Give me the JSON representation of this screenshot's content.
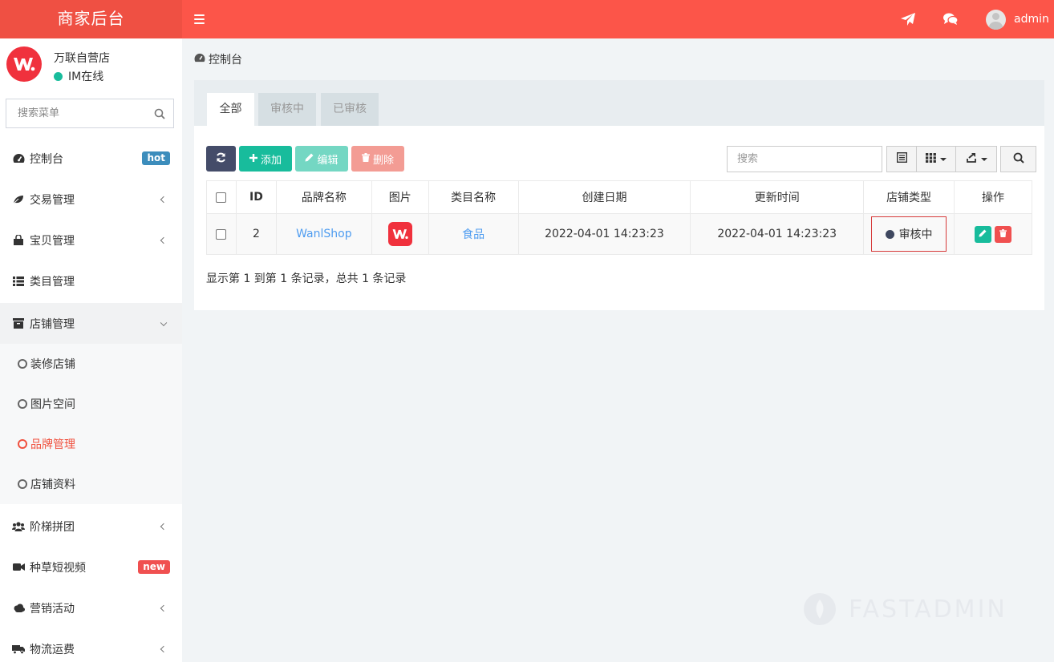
{
  "header": {
    "app_title": "商家后台",
    "username": "admin",
    "colors": {
      "bar": "#fc5549",
      "logo_bg": "#ef5043"
    }
  },
  "shop": {
    "name": "万联自营店",
    "status": "IM在线"
  },
  "sidebar": {
    "search_placeholder": "搜索菜单",
    "items": [
      {
        "label": "控制台",
        "icon": "dashboard-icon",
        "badge": "hot"
      },
      {
        "label": "交易管理",
        "icon": "leaf-icon"
      },
      {
        "label": "宝贝管理",
        "icon": "shopping-bag-icon"
      },
      {
        "label": "类目管理",
        "icon": "list-icon"
      },
      {
        "label": "店铺管理",
        "icon": "archive-icon",
        "expanded": true
      },
      {
        "label": "阶梯拼团",
        "icon": "users-icon"
      },
      {
        "label": "种草短视频",
        "icon": "video-icon",
        "badge": "new"
      },
      {
        "label": "营销活动",
        "icon": "cloud-icon"
      },
      {
        "label": "物流运费",
        "icon": "truck-icon"
      }
    ],
    "sub_items": [
      {
        "label": "装修店铺"
      },
      {
        "label": "图片空间"
      },
      {
        "label": "品牌管理",
        "active": true
      },
      {
        "label": "店铺资料"
      }
    ]
  },
  "breadcrumb": {
    "label": "控制台"
  },
  "tabs": [
    {
      "label": "全部",
      "active": true
    },
    {
      "label": "审核中"
    },
    {
      "label": "已审核"
    }
  ],
  "toolbar": {
    "add_label": "添加",
    "edit_label": "编辑",
    "delete_label": "删除",
    "search_placeholder": "搜索",
    "colors": {
      "refresh": "#444c69",
      "add": "#18bc9c",
      "edit": "#74d7c3",
      "delete": "#f39c94"
    }
  },
  "table": {
    "columns": [
      "ID",
      "品牌名称",
      "图片",
      "类目名称",
      "创建日期",
      "更新时间",
      "店铺类型",
      "操作"
    ],
    "rows": [
      {
        "id": "2",
        "brand": "WanlShop",
        "category": "食品",
        "created": "2022-04-01 14:23:23",
        "updated": "2022-04-01 14:23:23",
        "status": "审核中"
      }
    ],
    "summary": "显示第 1 到第 1 条记录，总共 1 条记录"
  },
  "watermark": "FASTADMIN"
}
